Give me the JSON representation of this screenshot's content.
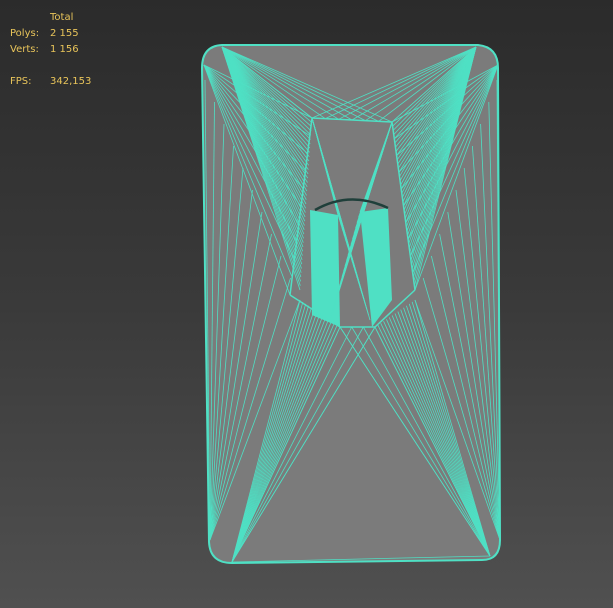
{
  "stats": {
    "header": "Total",
    "polys_label": "Polys:",
    "polys_value": "2 155",
    "verts_label": "Verts:",
    "verts_value": "1 156",
    "fps_label": "FPS:",
    "fps_value": "342,153"
  },
  "colors": {
    "wire": "#4fe0c4",
    "mesh": "#7b7b7b",
    "text": "#e8c45a"
  }
}
